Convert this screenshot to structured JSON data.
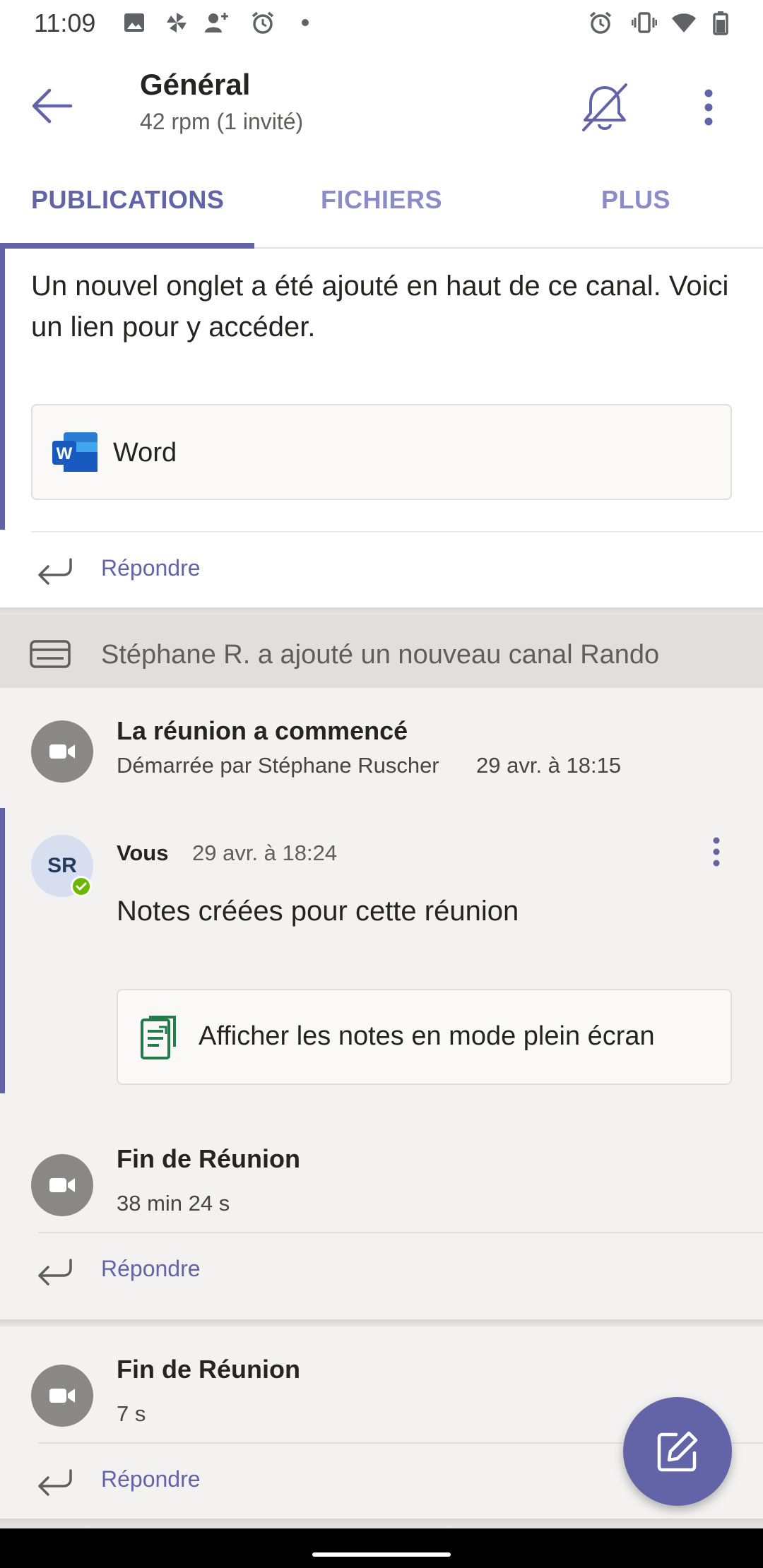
{
  "status_bar": {
    "time": "11:09",
    "left_icons": [
      "image-icon",
      "pinwheel-icon",
      "add-person-icon",
      "alarm-icon",
      "dot-icon"
    ],
    "right_icons": [
      "alarm-icon",
      "vibrate-icon",
      "wifi-icon",
      "battery-icon"
    ]
  },
  "header": {
    "title": "Général",
    "subtitle": "42 rpm  (1 invité)",
    "icons": [
      "back-arrow-icon",
      "bell-off-icon",
      "more-vertical-icon"
    ]
  },
  "tabs": [
    {
      "label": "PUBLICATIONS",
      "active": true
    },
    {
      "label": "FICHIERS",
      "active": false
    },
    {
      "label": "PLUS",
      "active": false
    }
  ],
  "post1": {
    "text": "Un nouvel onglet a été ajouté en haut de ce canal. Voici un lien pour y accéder.",
    "card_label": "Word",
    "reply_label": "Répondre"
  },
  "channel_banner": {
    "text": "Stéphane R. a ajouté un nouveau canal Rando"
  },
  "meeting": {
    "started_title": "La réunion a commencé",
    "started_by": "Démarrée par Stéphane Ruscher",
    "started_time": "29 avr. à 18:15",
    "message": {
      "avatar_initials": "SR",
      "author": "Vous",
      "time": "29 avr. à 18:24",
      "body": "Notes créées pour cette réunion",
      "card_label": "Afficher les notes en mode plein écran"
    },
    "end1_title": "Fin de Réunion",
    "end1_duration": "38 min 24 s",
    "reply1_label": "Répondre"
  },
  "meeting2": {
    "end_title": "Fin de Réunion",
    "end_duration": "7 s",
    "reply_label": "Répondre"
  },
  "fab": {
    "icon": "compose-icon"
  },
  "colors": {
    "accent": "#6264a7",
    "tab_inactive": "#8b8cc7",
    "presence": "#6bb700",
    "meeting_avatar": "#8a8886"
  }
}
